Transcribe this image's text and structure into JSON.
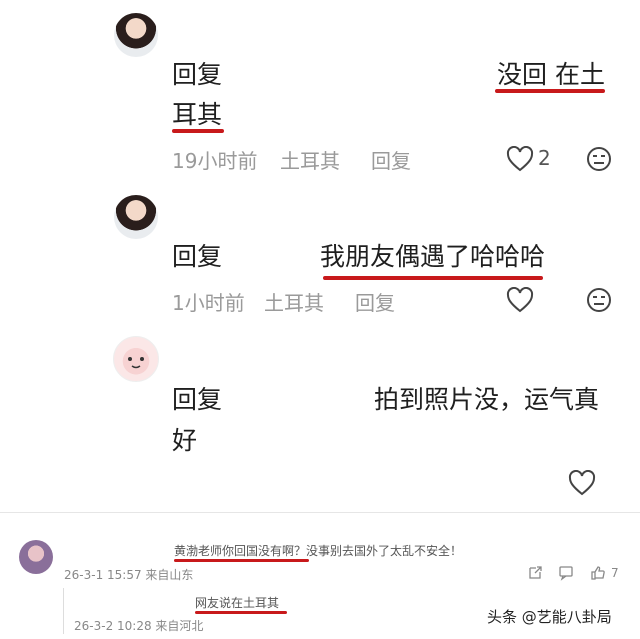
{
  "comments": [
    {
      "reply_label": "回复",
      "text_a": "没回 在土",
      "text_b": "耳其",
      "time": "19小时前",
      "location": "土耳其",
      "reply_action": "回复",
      "likes": "2"
    },
    {
      "reply_label": "回复",
      "text": "我朋友偶遇了哈哈哈",
      "time": "1小时前",
      "location": "土耳其",
      "reply_action": "回复"
    },
    {
      "reply_label": "回复",
      "text_a": "拍到照片没，运气真",
      "text_b": "好"
    }
  ],
  "embedded": {
    "comment_text": "黄渤老师你回国没有啊？没事别去国外了太乱不安全！",
    "comment_meta": "26-3-1 15:57 来自山东",
    "likes": "7",
    "reply_text": "网友说在土耳其",
    "reply_meta": "26-3-2 10:28 来自河北"
  },
  "watermark": "头条 @艺能八卦局",
  "colors": {
    "highlight": "#c8191b",
    "meta": "#9a9a9a"
  }
}
